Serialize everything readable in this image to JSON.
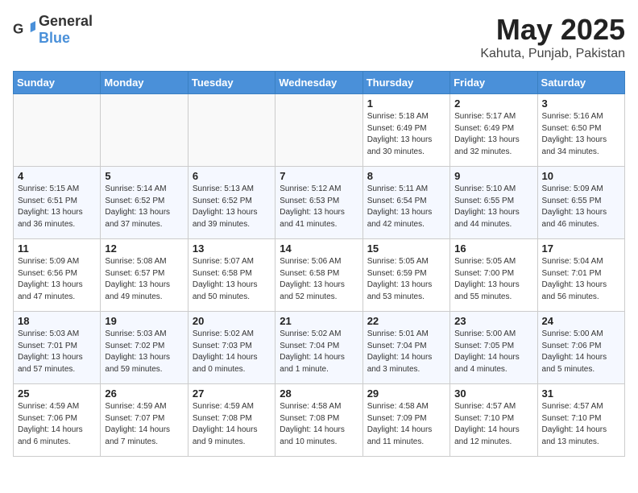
{
  "header": {
    "logo_general": "General",
    "logo_blue": "Blue",
    "month": "May 2025",
    "location": "Kahuta, Punjab, Pakistan"
  },
  "weekdays": [
    "Sunday",
    "Monday",
    "Tuesday",
    "Wednesday",
    "Thursday",
    "Friday",
    "Saturday"
  ],
  "weeks": [
    [
      {
        "day": "",
        "sunrise": "",
        "sunset": "",
        "daylight": ""
      },
      {
        "day": "",
        "sunrise": "",
        "sunset": "",
        "daylight": ""
      },
      {
        "day": "",
        "sunrise": "",
        "sunset": "",
        "daylight": ""
      },
      {
        "day": "",
        "sunrise": "",
        "sunset": "",
        "daylight": ""
      },
      {
        "day": "1",
        "sunrise": "Sunrise: 5:18 AM",
        "sunset": "Sunset: 6:49 PM",
        "daylight": "Daylight: 13 hours and 30 minutes."
      },
      {
        "day": "2",
        "sunrise": "Sunrise: 5:17 AM",
        "sunset": "Sunset: 6:49 PM",
        "daylight": "Daylight: 13 hours and 32 minutes."
      },
      {
        "day": "3",
        "sunrise": "Sunrise: 5:16 AM",
        "sunset": "Sunset: 6:50 PM",
        "daylight": "Daylight: 13 hours and 34 minutes."
      }
    ],
    [
      {
        "day": "4",
        "sunrise": "Sunrise: 5:15 AM",
        "sunset": "Sunset: 6:51 PM",
        "daylight": "Daylight: 13 hours and 36 minutes."
      },
      {
        "day": "5",
        "sunrise": "Sunrise: 5:14 AM",
        "sunset": "Sunset: 6:52 PM",
        "daylight": "Daylight: 13 hours and 37 minutes."
      },
      {
        "day": "6",
        "sunrise": "Sunrise: 5:13 AM",
        "sunset": "Sunset: 6:52 PM",
        "daylight": "Daylight: 13 hours and 39 minutes."
      },
      {
        "day": "7",
        "sunrise": "Sunrise: 5:12 AM",
        "sunset": "Sunset: 6:53 PM",
        "daylight": "Daylight: 13 hours and 41 minutes."
      },
      {
        "day": "8",
        "sunrise": "Sunrise: 5:11 AM",
        "sunset": "Sunset: 6:54 PM",
        "daylight": "Daylight: 13 hours and 42 minutes."
      },
      {
        "day": "9",
        "sunrise": "Sunrise: 5:10 AM",
        "sunset": "Sunset: 6:55 PM",
        "daylight": "Daylight: 13 hours and 44 minutes."
      },
      {
        "day": "10",
        "sunrise": "Sunrise: 5:09 AM",
        "sunset": "Sunset: 6:55 PM",
        "daylight": "Daylight: 13 hours and 46 minutes."
      }
    ],
    [
      {
        "day": "11",
        "sunrise": "Sunrise: 5:09 AM",
        "sunset": "Sunset: 6:56 PM",
        "daylight": "Daylight: 13 hours and 47 minutes."
      },
      {
        "day": "12",
        "sunrise": "Sunrise: 5:08 AM",
        "sunset": "Sunset: 6:57 PM",
        "daylight": "Daylight: 13 hours and 49 minutes."
      },
      {
        "day": "13",
        "sunrise": "Sunrise: 5:07 AM",
        "sunset": "Sunset: 6:58 PM",
        "daylight": "Daylight: 13 hours and 50 minutes."
      },
      {
        "day": "14",
        "sunrise": "Sunrise: 5:06 AM",
        "sunset": "Sunset: 6:58 PM",
        "daylight": "Daylight: 13 hours and 52 minutes."
      },
      {
        "day": "15",
        "sunrise": "Sunrise: 5:05 AM",
        "sunset": "Sunset: 6:59 PM",
        "daylight": "Daylight: 13 hours and 53 minutes."
      },
      {
        "day": "16",
        "sunrise": "Sunrise: 5:05 AM",
        "sunset": "Sunset: 7:00 PM",
        "daylight": "Daylight: 13 hours and 55 minutes."
      },
      {
        "day": "17",
        "sunrise": "Sunrise: 5:04 AM",
        "sunset": "Sunset: 7:01 PM",
        "daylight": "Daylight: 13 hours and 56 minutes."
      }
    ],
    [
      {
        "day": "18",
        "sunrise": "Sunrise: 5:03 AM",
        "sunset": "Sunset: 7:01 PM",
        "daylight": "Daylight: 13 hours and 57 minutes."
      },
      {
        "day": "19",
        "sunrise": "Sunrise: 5:03 AM",
        "sunset": "Sunset: 7:02 PM",
        "daylight": "Daylight: 13 hours and 59 minutes."
      },
      {
        "day": "20",
        "sunrise": "Sunrise: 5:02 AM",
        "sunset": "Sunset: 7:03 PM",
        "daylight": "Daylight: 14 hours and 0 minutes."
      },
      {
        "day": "21",
        "sunrise": "Sunrise: 5:02 AM",
        "sunset": "Sunset: 7:04 PM",
        "daylight": "Daylight: 14 hours and 1 minute."
      },
      {
        "day": "22",
        "sunrise": "Sunrise: 5:01 AM",
        "sunset": "Sunset: 7:04 PM",
        "daylight": "Daylight: 14 hours and 3 minutes."
      },
      {
        "day": "23",
        "sunrise": "Sunrise: 5:00 AM",
        "sunset": "Sunset: 7:05 PM",
        "daylight": "Daylight: 14 hours and 4 minutes."
      },
      {
        "day": "24",
        "sunrise": "Sunrise: 5:00 AM",
        "sunset": "Sunset: 7:06 PM",
        "daylight": "Daylight: 14 hours and 5 minutes."
      }
    ],
    [
      {
        "day": "25",
        "sunrise": "Sunrise: 4:59 AM",
        "sunset": "Sunset: 7:06 PM",
        "daylight": "Daylight: 14 hours and 6 minutes."
      },
      {
        "day": "26",
        "sunrise": "Sunrise: 4:59 AM",
        "sunset": "Sunset: 7:07 PM",
        "daylight": "Daylight: 14 hours and 7 minutes."
      },
      {
        "day": "27",
        "sunrise": "Sunrise: 4:59 AM",
        "sunset": "Sunset: 7:08 PM",
        "daylight": "Daylight: 14 hours and 9 minutes."
      },
      {
        "day": "28",
        "sunrise": "Sunrise: 4:58 AM",
        "sunset": "Sunset: 7:08 PM",
        "daylight": "Daylight: 14 hours and 10 minutes."
      },
      {
        "day": "29",
        "sunrise": "Sunrise: 4:58 AM",
        "sunset": "Sunset: 7:09 PM",
        "daylight": "Daylight: 14 hours and 11 minutes."
      },
      {
        "day": "30",
        "sunrise": "Sunrise: 4:57 AM",
        "sunset": "Sunset: 7:10 PM",
        "daylight": "Daylight: 14 hours and 12 minutes."
      },
      {
        "day": "31",
        "sunrise": "Sunrise: 4:57 AM",
        "sunset": "Sunset: 7:10 PM",
        "daylight": "Daylight: 14 hours and 13 minutes."
      }
    ]
  ]
}
